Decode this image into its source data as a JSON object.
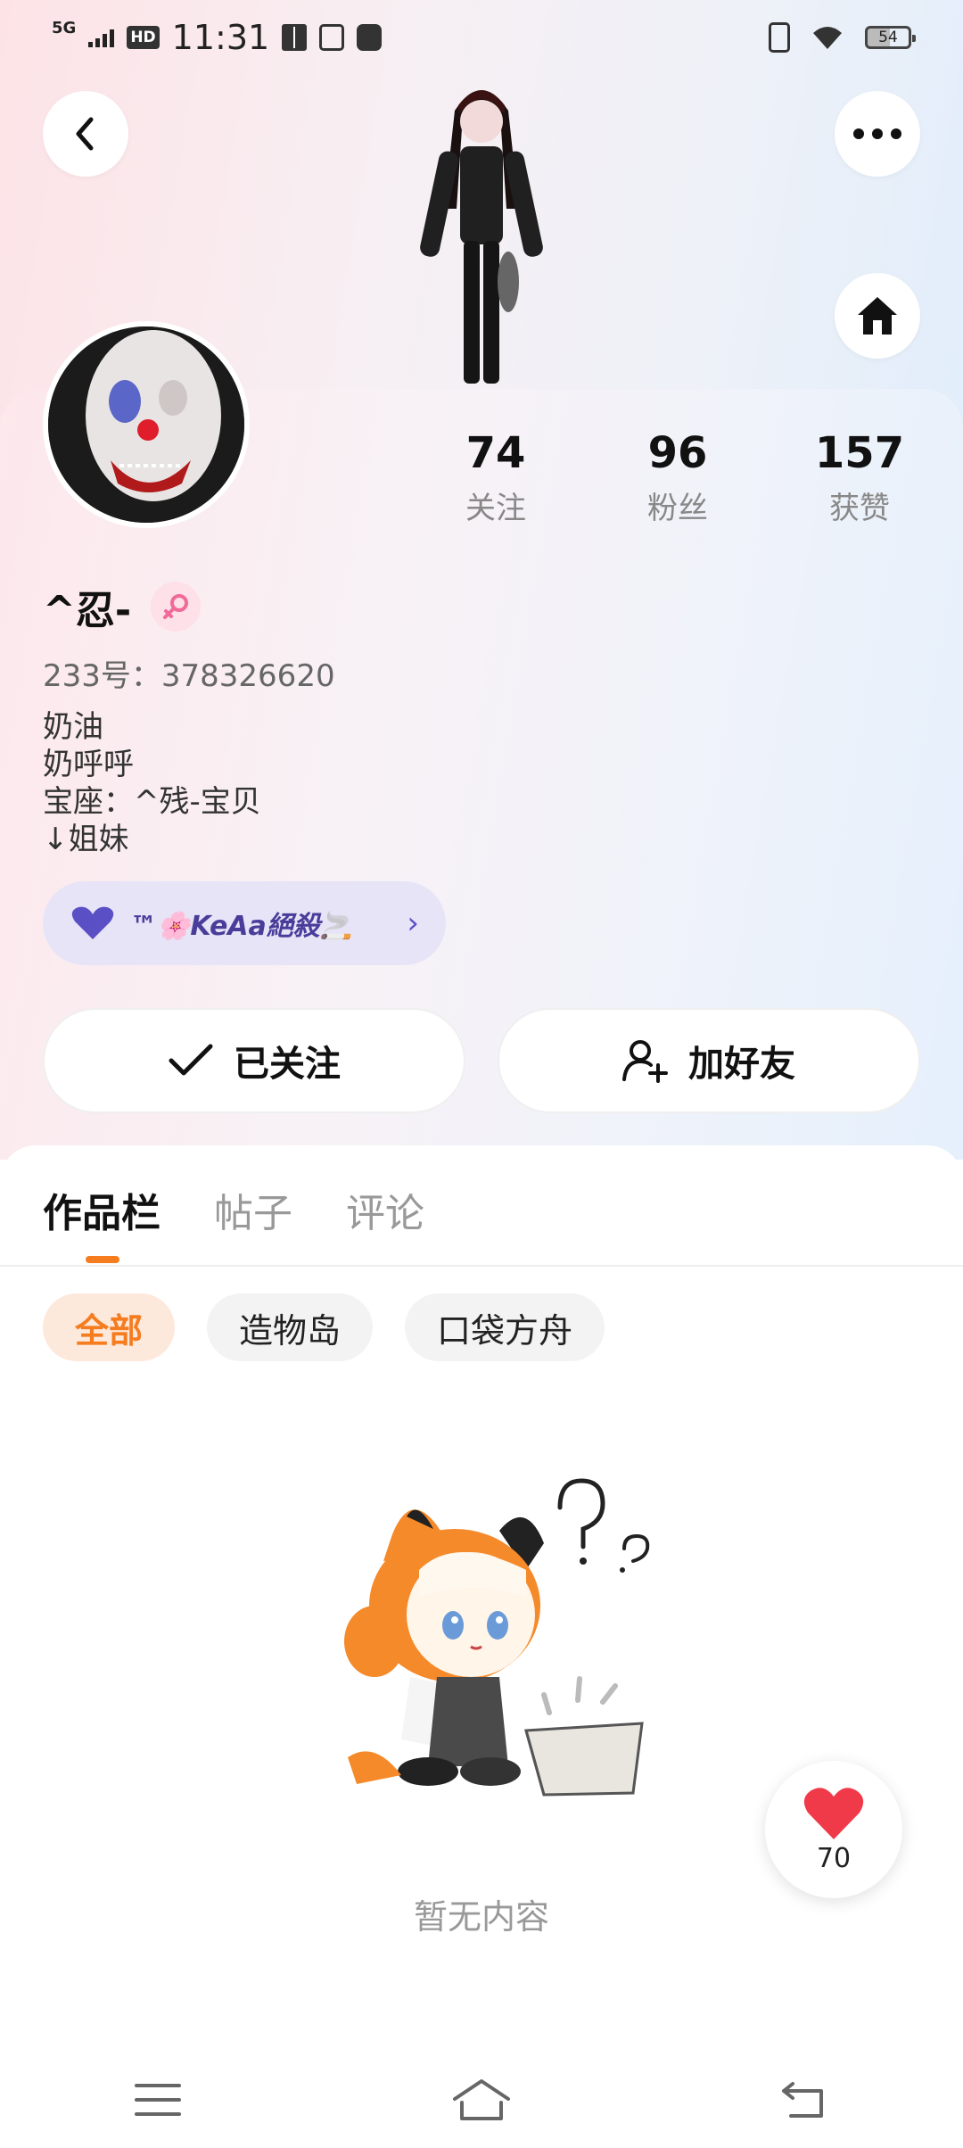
{
  "status_bar": {
    "network": "5G",
    "hd": "HD",
    "time": "11:31",
    "battery": "54"
  },
  "profile": {
    "stats": [
      {
        "value": "74",
        "label": "关注"
      },
      {
        "value": "96",
        "label": "粉丝"
      },
      {
        "value": "157",
        "label": "获赞"
      }
    ],
    "nickname": "^忍-",
    "uid": "233号：378326620",
    "bio_lines": [
      "奶油",
      "奶呼呼",
      "宝座：^残-宝贝",
      "↓姐妹"
    ],
    "guild_name": "™🌸KeAa絕殺🚬"
  },
  "actions": {
    "following_label": "已关注",
    "add_friend_label": "加好友"
  },
  "tabs": [
    {
      "label": "作品栏",
      "active": true
    },
    {
      "label": "帖子",
      "active": false
    },
    {
      "label": "评论",
      "active": false
    }
  ],
  "filters": [
    {
      "label": "全部",
      "active": true
    },
    {
      "label": "造物岛",
      "active": false
    },
    {
      "label": "口袋方舟",
      "active": false
    }
  ],
  "empty": {
    "text": "暂无内容"
  },
  "like": {
    "count": "70"
  },
  "colors": {
    "accent": "#f57c1f",
    "heart": "#f03a4a"
  }
}
